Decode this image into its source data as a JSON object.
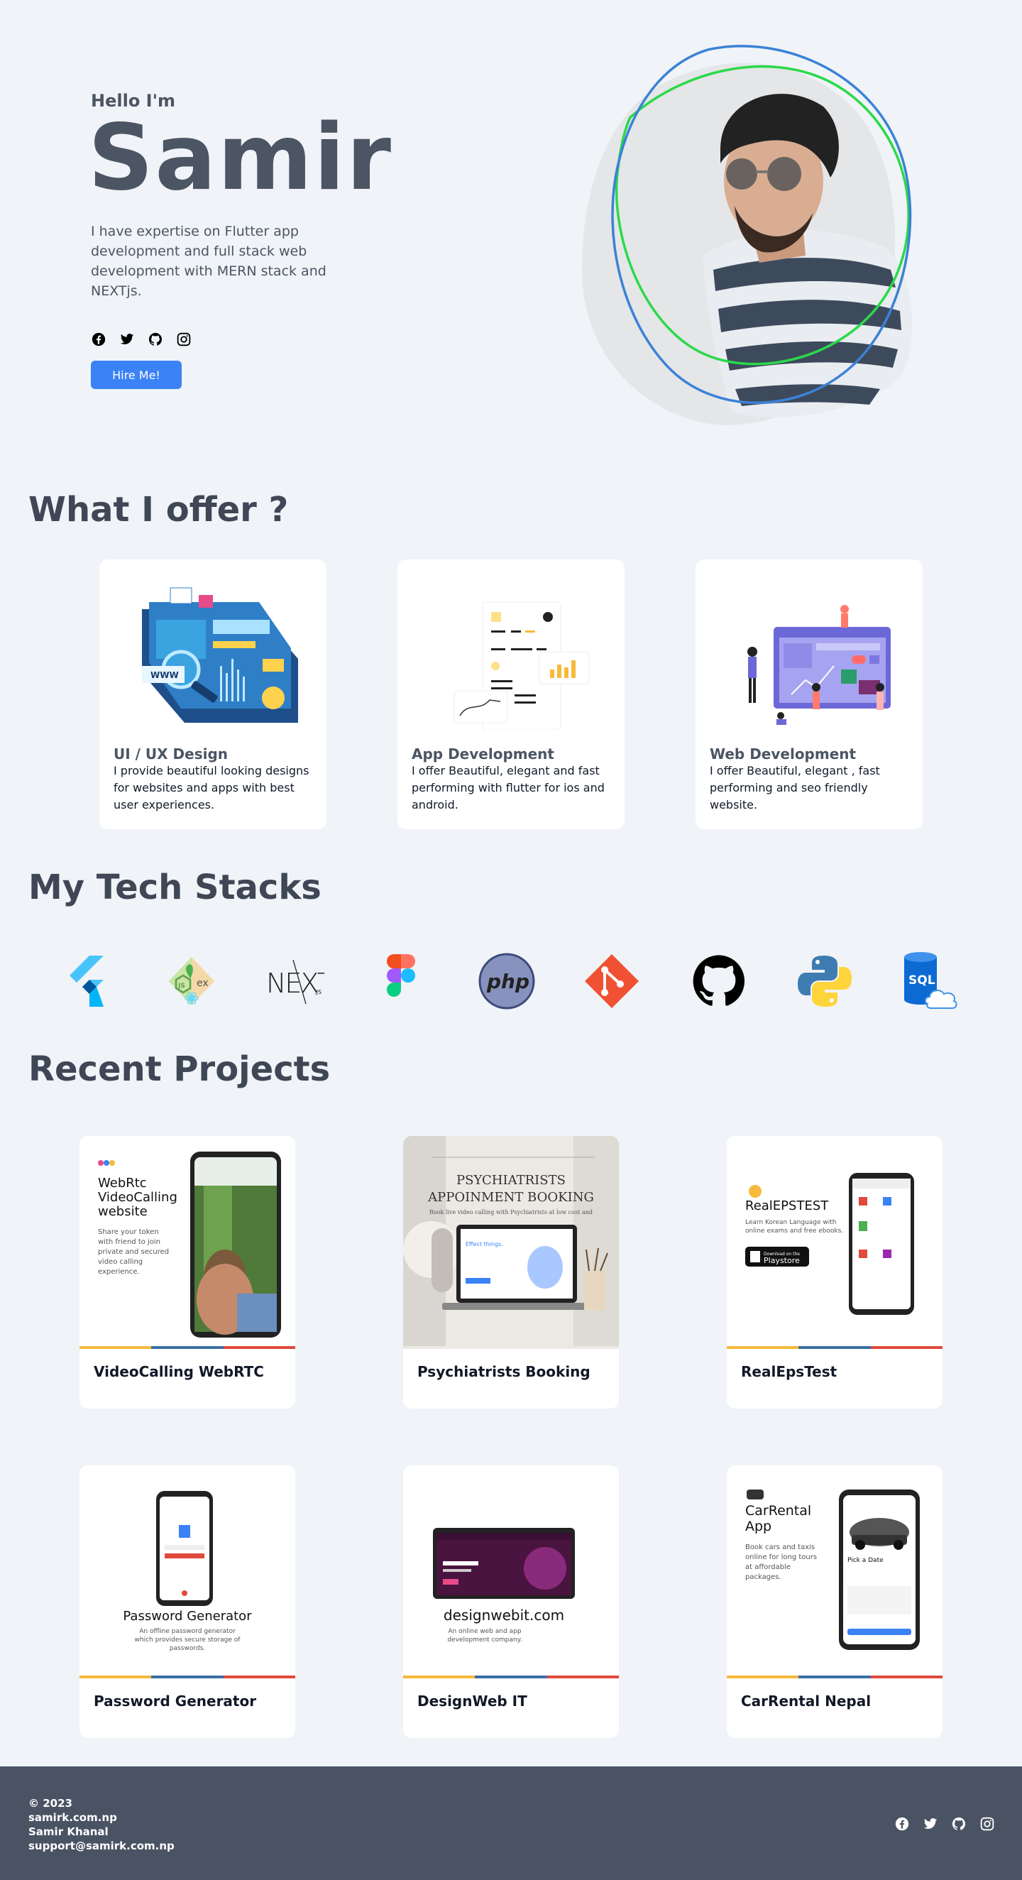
{
  "hero": {
    "greeting": "Hello I'm",
    "name": "Samir",
    "bio": "I have expertise on Flutter app development and full stack web development with MERN stack and NEXTjs.",
    "social_icons": [
      "facebook-icon",
      "twitter-icon",
      "github-icon",
      "instagram-icon"
    ],
    "hire_label": "Hire Me!"
  },
  "offers": {
    "title": "What I offer ?",
    "items": [
      {
        "title": "UI / UX Design",
        "desc": "I provide beautiful looking designs for websites and apps with best user experiences."
      },
      {
        "title": "App Development",
        "desc": "I offer Beautiful, elegant and fast performing with flutter for ios and android."
      },
      {
        "title": "Web Development",
        "desc": "I offer Beautiful, elegant , fast performing and seo friendly website."
      }
    ]
  },
  "tech": {
    "title": "My Tech Stacks",
    "items": [
      "flutter-icon",
      "nodejs-express-icon",
      "nextjs-icon",
      "figma-icon",
      "php-icon",
      "git-icon",
      "github-icon",
      "python-icon",
      "sql-icon"
    ],
    "labels": {
      "express": "ex",
      "next": "NEXT",
      "next_js": ".JS",
      "php": "php",
      "sql": "SQL"
    }
  },
  "projects": {
    "title": "Recent Projects",
    "items": [
      {
        "title": "VideoCalling WebRTC"
      },
      {
        "title": "Psychiatrists Booking"
      },
      {
        "title": "RealEpsTest"
      },
      {
        "title": "Password Generator"
      },
      {
        "title": "DesignWeb IT"
      },
      {
        "title": "CarRental Nepal"
      }
    ],
    "art": {
      "p1": {
        "head1": "WebRtc",
        "head2": "VideoCalling",
        "head3": "website",
        "sub1": "Share your token",
        "sub2": "with friend to join",
        "sub3": "private and secured",
        "sub4": "video calling",
        "sub5": "experience."
      },
      "p2": {
        "head1": "PSYCHIATRISTS",
        "head2": "APPOINMENT BOOKING",
        "sub": "Book live video calling with Psychiatrists at low cost and"
      },
      "p3": {
        "head": "RealEPSTEST",
        "sub1": "Learn Korean Language with",
        "sub2": "online exams and free ebooks.",
        "store_small": "Download on the",
        "store": "Playstore"
      },
      "p4": {
        "head": "Password Generator",
        "sub1": "An offline password generator",
        "sub2": "which provides secure storage of",
        "sub3": "passwords."
      },
      "p5": {
        "head": "designwebit.com",
        "sub1": "An online web and app",
        "sub2": "development company."
      },
      "p6": {
        "head1": "CarRental",
        "head2": "App",
        "sub1": "Book cars and taxis",
        "sub2": "online for long tours",
        "sub3": "at affordable",
        "sub4": "packages.",
        "pick": "Pick a Date"
      }
    }
  },
  "footer": {
    "year": "© 2023",
    "domain": "samirk.com.np",
    "owner": "Samir Khanal",
    "email": "support@samirk.com.np",
    "social_icons": [
      "facebook-icon",
      "twitter-icon",
      "github-icon",
      "instagram-icon"
    ]
  },
  "colors": {
    "background": "#f0f3f7",
    "text": "#4b5563",
    "accent": "#3b82f6",
    "footer": "#4a5363",
    "bar_yellow": "#f6b93b",
    "bar_blue": "#3b6ea5",
    "bar_red": "#e04a3c"
  }
}
